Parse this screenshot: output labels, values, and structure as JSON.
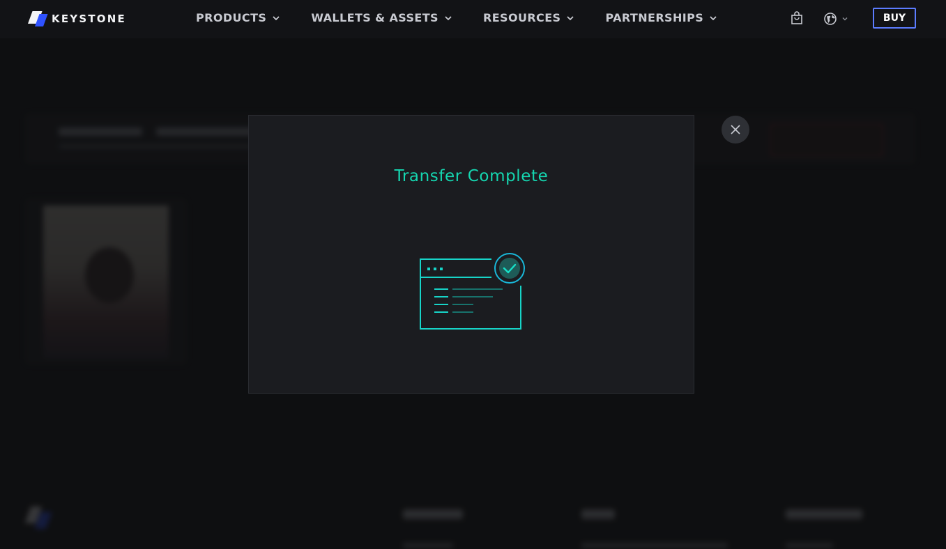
{
  "header": {
    "brand": "KEYSTONE",
    "nav": [
      {
        "label": "PRODUCTS"
      },
      {
        "label": "WALLETS & ASSETS"
      },
      {
        "label": "RESOURCES"
      },
      {
        "label": "PARTNERSHIPS"
      }
    ],
    "buy_label": "BUY",
    "icons": {
      "cart": "shopping-bag-icon",
      "language": "globe-icon",
      "dropdown": "chevron-down-icon"
    }
  },
  "modal": {
    "title": "Transfer Complete",
    "illustration": "document-check-icon",
    "close_icon": "close-icon"
  },
  "colors": {
    "background": "#121316",
    "accent_teal": "#15d6b0",
    "accent_blue": "#5c7cff",
    "modal_bg": "#1b1c20"
  }
}
